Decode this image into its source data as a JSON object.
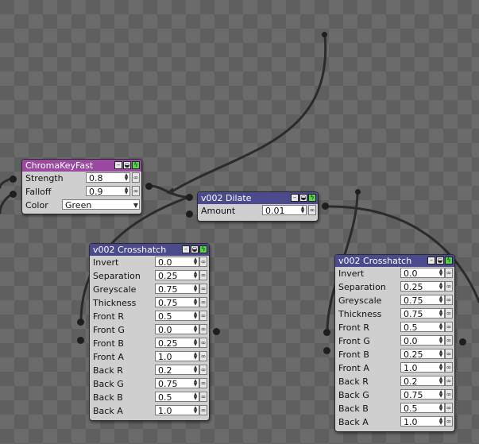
{
  "colors": {
    "chroma_header": "#9a4aa0",
    "node_header": "#4b4a8c",
    "bolt": "#56d44c",
    "wire": "#2b2b2b"
  },
  "chroma": {
    "title": "ChromaKeyFast",
    "strength_label": "Strength",
    "strength": "0.8",
    "falloff_label": "Falloff",
    "falloff": "0.9",
    "color_label": "Color",
    "color": "Green"
  },
  "dilate": {
    "title": "v002 Dilate",
    "amount_label": "Amount",
    "amount": "0.01"
  },
  "cross1": {
    "title": "v002 Crosshatch",
    "rows": [
      {
        "label": "Invert",
        "value": "0.0"
      },
      {
        "label": "Separation",
        "value": "0.25"
      },
      {
        "label": "Greyscale",
        "value": "0.75"
      },
      {
        "label": "Thickness",
        "value": "0.75"
      },
      {
        "label": "Front R",
        "value": "0.5"
      },
      {
        "label": "Front G",
        "value": "0.0"
      },
      {
        "label": "Front B",
        "value": "0.25"
      },
      {
        "label": "Front A",
        "value": "1.0"
      },
      {
        "label": "Back R",
        "value": "0.2"
      },
      {
        "label": "Back G",
        "value": "0.75"
      },
      {
        "label": "Back B",
        "value": "0.5"
      },
      {
        "label": "Back A",
        "value": "1.0"
      }
    ]
  },
  "cross2": {
    "title": "v002 Crosshatch",
    "rows": [
      {
        "label": "Invert",
        "value": "0.0"
      },
      {
        "label": "Separation",
        "value": "0.25"
      },
      {
        "label": "Greyscale",
        "value": "0.75"
      },
      {
        "label": "Thickness",
        "value": "0.75"
      },
      {
        "label": "Front R",
        "value": "0.5"
      },
      {
        "label": "Front G",
        "value": "0.0"
      },
      {
        "label": "Front B",
        "value": "0.25"
      },
      {
        "label": "Front A",
        "value": "1.0"
      },
      {
        "label": "Back R",
        "value": "0.2"
      },
      {
        "label": "Back G",
        "value": "0.75"
      },
      {
        "label": "Back B",
        "value": "0.5"
      },
      {
        "label": "Back A",
        "value": "1.0"
      }
    ]
  }
}
